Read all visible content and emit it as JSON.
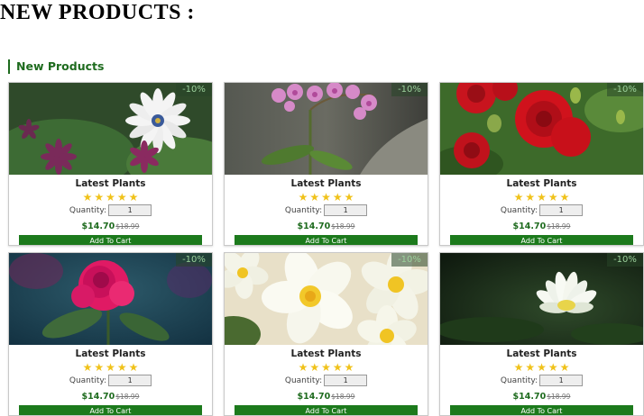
{
  "page_heading": "NEW PRODUCTS :",
  "section_title": "New Products",
  "products": [
    {
      "image": "white-daisy-photo",
      "discount": "-10%",
      "title": "Latest Plants",
      "rating": 5,
      "quantity_label": "Quantity:",
      "quantity": "1",
      "price": "$14.70",
      "old_price": "$18.99",
      "button": "Add To Cart"
    },
    {
      "image": "pink-orchid-photo",
      "discount": "-10%",
      "title": "Latest Plants",
      "rating": 5,
      "quantity_label": "Quantity:",
      "quantity": "1",
      "price": "$14.70",
      "old_price": "$18.99",
      "button": "Add To Cart"
    },
    {
      "image": "red-roses-photo",
      "discount": "-10%",
      "title": "Latest Plants",
      "rating": 5,
      "quantity_label": "Quantity:",
      "quantity": "1",
      "price": "$14.70",
      "old_price": "$18.99",
      "button": "Add To Cart"
    },
    {
      "image": "pink-rose-photo",
      "discount": "-10%",
      "title": "Latest Plants",
      "rating": 5,
      "quantity_label": "Quantity:",
      "quantity": "1",
      "price": "$14.70",
      "old_price": "$18.99",
      "button": "Add To Cart"
    },
    {
      "image": "frangipani-photo",
      "discount": "-10%",
      "title": "Latest Plants",
      "rating": 5,
      "quantity_label": "Quantity:",
      "quantity": "1",
      "price": "$14.70",
      "old_price": "$18.99",
      "button": "Add To Cart"
    },
    {
      "image": "white-lotus-photo",
      "discount": "-10%",
      "title": "Latest Plants",
      "rating": 5,
      "quantity_label": "Quantity:",
      "quantity": "1",
      "price": "$14.70",
      "old_price": "$18.99",
      "button": "Add To Cart"
    }
  ],
  "colors": {
    "brand_green": "#1e6b1e",
    "button_green": "#1c7a1c",
    "star": "#f0c21a"
  }
}
